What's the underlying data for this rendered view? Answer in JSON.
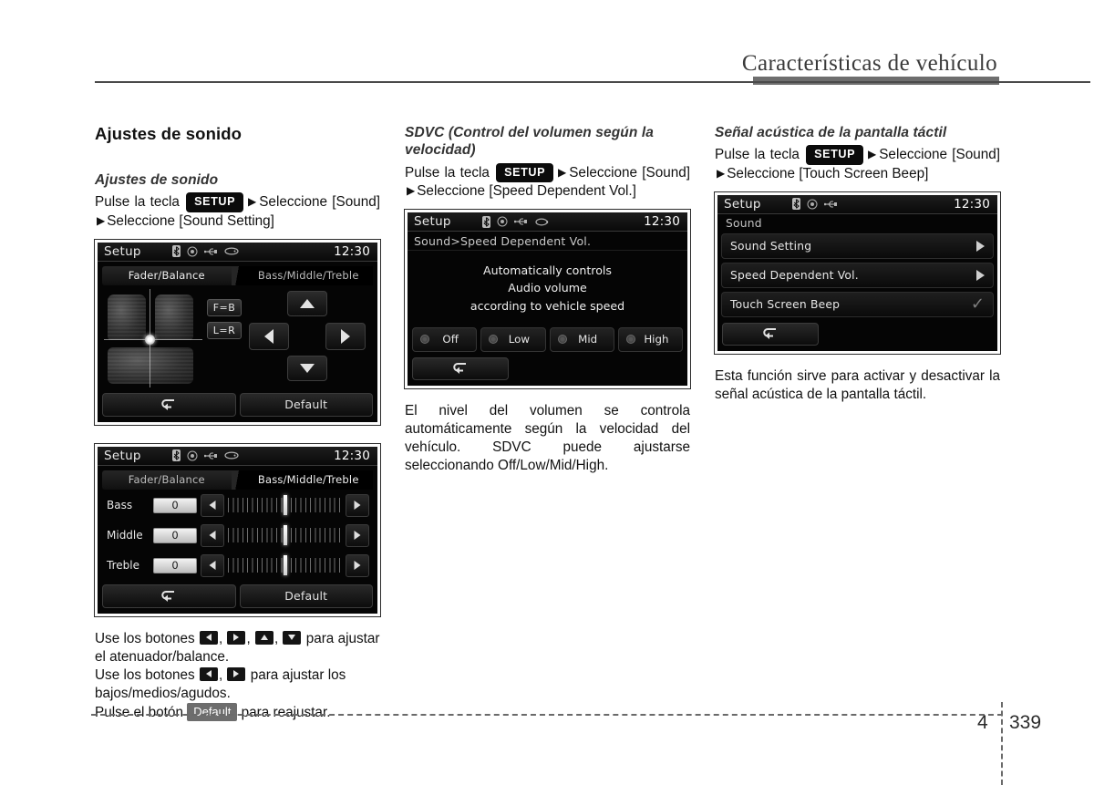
{
  "header": {
    "title": "Características de vehículo"
  },
  "footer": {
    "chapter": "4",
    "page": "339"
  },
  "columns": {
    "col1": {
      "section_title": "Ajustes de sonido",
      "sub_title": "Ajustes de sonido",
      "instr_p1": "Pulse la tecla",
      "setup_key": "SETUP",
      "instr_p2": "Seleccione [Sound]",
      "instr_p3": "Seleccione [Sound Setting]",
      "note1_a": "Use los botones",
      "note1_b": ", ",
      "note1_c": " para ajustar el atenuador/balance.",
      "note2_a": "Use los botones",
      "note2_c": " para ajustar los bajos/medios/agudos.",
      "note3_a": "Pulse el botón",
      "note3_btn": "Default",
      "note3_b": "para reajustar."
    },
    "col2": {
      "sub_title": "SDVC (Control del volumen según la velocidad)",
      "instr_p1": "Pulse la tecla",
      "setup_key": "SETUP",
      "instr_p2": "Seleccione [Sound]",
      "instr_p3": "Seleccione [Speed Dependent Vol.]",
      "note": "El nivel del volumen se controla automáticamente según la velocidad del vehículo. SDVC puede ajustarse seleccionando Off/Low/Mid/High."
    },
    "col3": {
      "sub_title": "Señal acústica de la pantalla táctil",
      "instr_p1": "Pulse la tecla",
      "setup_key": "SETUP",
      "instr_p2": "Seleccione [Sound]",
      "instr_p3": "Seleccione [Touch Screen Beep]",
      "note": "Esta función sirve para activar y desactivar la señal acústica de la pantalla táctil."
    }
  },
  "screens": {
    "fader": {
      "status_title": "Setup",
      "clock": "12:30",
      "tab_left": "Fader/Balance",
      "tab_right": "Bass/Middle/Treble",
      "eq_fb": "F=B",
      "eq_lr": "L=R",
      "default_label": "Default"
    },
    "tone": {
      "status_title": "Setup",
      "clock": "12:30",
      "tab_left": "Fader/Balance",
      "tab_right": "Bass/Middle/Treble",
      "rows": [
        {
          "label": "Bass",
          "value": "0"
        },
        {
          "label": "Middle",
          "value": "0"
        },
        {
          "label": "Treble",
          "value": "0"
        }
      ],
      "default_label": "Default"
    },
    "sdvc": {
      "status_title": "Setup",
      "clock": "12:30",
      "breadcrumb": "Sound>Speed Dependent Vol.",
      "message_line1": "Automatically controls",
      "message_line2": "Audio volume",
      "message_line3": "according to vehicle speed",
      "options": [
        "Off",
        "Low",
        "Mid",
        "High"
      ]
    },
    "sound_menu": {
      "status_title": "Setup",
      "clock": "12:30",
      "menu_title": "Sound",
      "items": [
        {
          "label": "Sound Setting",
          "accessory": "chevron"
        },
        {
          "label": "Speed Dependent Vol.",
          "accessory": "chevron"
        },
        {
          "label": "Touch Screen Beep",
          "accessory": "check"
        }
      ]
    }
  },
  "icons": {
    "bluetooth": "bluetooth-icon",
    "disc": "disc-icon",
    "usb": "usb-icon",
    "aux": "aux-icon",
    "back": "back-arrow-icon"
  }
}
